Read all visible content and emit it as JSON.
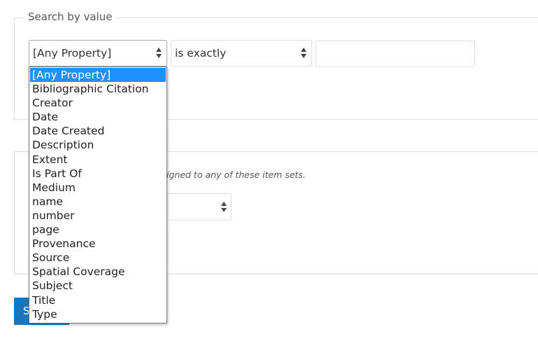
{
  "search_by_value": {
    "legend": "Search by value",
    "property_select": {
      "value": "[Any Property]"
    },
    "operator_select": {
      "value": "is exactly"
    },
    "value_input": {
      "value": ""
    },
    "property_options": [
      "[Any Property]",
      "Bibliographic Citation",
      "Creator",
      "Date",
      "Date Created",
      "Description",
      "Extent",
      "Is Part Of",
      "Medium",
      "name",
      "number",
      "page",
      "Provenance",
      "Source",
      "Spatial Coverage",
      "Subject",
      "Title",
      "Type"
    ]
  },
  "item_sets": {
    "hint": "igned to any of these item sets."
  },
  "submit": {
    "label": "S"
  },
  "colors": {
    "accent": "#1b75bb",
    "selected_option": "#1e90ff"
  }
}
